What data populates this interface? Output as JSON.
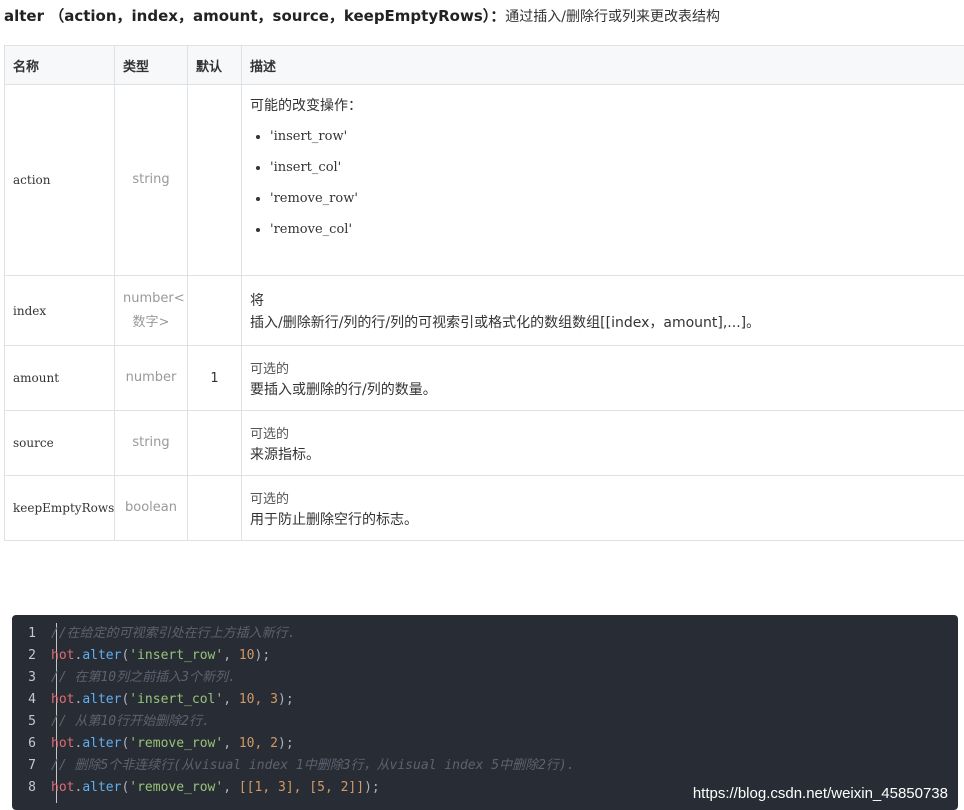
{
  "heading": {
    "signature": "alter （action，index，amount，source，keepEmptyRows）：",
    "description": "通过插入/删除行或列来更改表结构"
  },
  "table": {
    "headers": [
      "名称",
      "类型",
      "默认",
      "描述"
    ],
    "rows": [
      {
        "name": "action",
        "type": "string",
        "default": "",
        "desc_lead": "可能的改变操作：",
        "options": [
          "'insert_row'",
          "'insert_col'",
          "'remove_row'",
          "'remove_col'"
        ]
      },
      {
        "name": "index",
        "type": "number<数字>",
        "default": "",
        "desc_line1": "将",
        "desc_line2": "插入/删除新行/列的行/列的可视索引或格式化的数组数组[[index，amount],...]。"
      },
      {
        "name": "amount",
        "type": "number",
        "default": "1",
        "optional": "可选的",
        "desc": "要插入或删除的行/列的数量。"
      },
      {
        "name": "source",
        "type": "string",
        "default": "",
        "optional": "可选的",
        "desc": "来源指标。"
      },
      {
        "name": "keepEmptyRows",
        "type": "boolean",
        "default": "",
        "optional": "可选的",
        "desc": "用于防止删除空行的标志。"
      }
    ]
  },
  "code": {
    "lines": [
      {
        "num": "1",
        "comment": "//在给定的可视索引处在行上方插入新行."
      },
      {
        "num": "2",
        "obj": "hot",
        "fn": "alter",
        "str": "'insert_row'",
        "args": ", ",
        "nums": "10",
        "tail": ");"
      },
      {
        "num": "3",
        "comment": "// 在第10列之前插入3个新列."
      },
      {
        "num": "4",
        "obj": "hot",
        "fn": "alter",
        "str": "'insert_col'",
        "args": ", ",
        "nums": "10, 3",
        "tail": ");"
      },
      {
        "num": "5",
        "comment": "// 从第10行开始删除2行."
      },
      {
        "num": "6",
        "obj": "hot",
        "fn": "alter",
        "str": "'remove_row'",
        "args": ", ",
        "nums": "10, 2",
        "tail": ");"
      },
      {
        "num": "7",
        "comment": "// 删除5个非连续行(从visual index 1中删除3行，从visual index 5中删除2行)."
      },
      {
        "num": "8",
        "obj": "hot",
        "fn": "alter",
        "str": "'remove_row'",
        "args": ", ",
        "nums": "[[1, 3], [5, 2]]",
        "tail": ");"
      }
    ]
  },
  "watermark": "https://blog.csdn.net/weixin_45850738"
}
